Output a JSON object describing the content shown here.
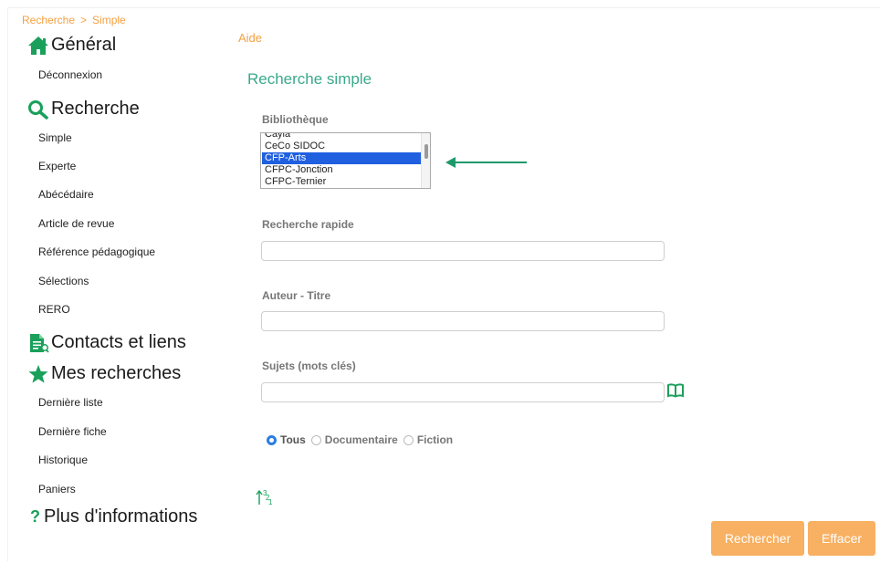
{
  "breadcrumb": {
    "part1": "Recherche",
    "sep": ">",
    "part2": "Simple"
  },
  "sidebar": {
    "general": {
      "title": "Général",
      "items": [
        "Déconnexion"
      ]
    },
    "recherche": {
      "title": "Recherche",
      "items": [
        "Simple",
        "Experte",
        "Abécédaire",
        "Article de revue",
        "Référence pédagogique",
        "Sélections",
        "RERO"
      ]
    },
    "contacts": {
      "title": "Contacts et liens"
    },
    "mes_recherches": {
      "title": "Mes recherches",
      "items": [
        "Dernière liste",
        "Dernière fiche",
        "Historique",
        "Paniers"
      ]
    },
    "plus": {
      "title": "Plus d'informations"
    }
  },
  "main": {
    "help": "Aide",
    "title": "Recherche simple",
    "bibliotheque": {
      "label": "Bibliothèque",
      "options": [
        "Cayla",
        "CeCo SIDOC",
        "CFP-Arts",
        "CFPC-Jonction",
        "CFPC-Ternier"
      ],
      "selected": "CFP-Arts"
    },
    "recherche_rapide": {
      "label": "Recherche rapide",
      "value": "",
      "placeholder": ""
    },
    "auteur_titre": {
      "label": "Auteur - Titre",
      "value": "",
      "placeholder": ""
    },
    "sujets": {
      "label": "Sujets (mots clés)",
      "value": "",
      "placeholder": ""
    },
    "type_filter": {
      "options": [
        "Tous",
        "Documentaire",
        "Fiction"
      ],
      "selected": "Tous"
    },
    "buttons": {
      "search": "Rechercher",
      "clear": "Effacer"
    }
  },
  "colors": {
    "accent_orange": "#f5a042",
    "title_green": "#39a98a",
    "button_orange": "#f8b062",
    "selection_blue": "#1f5fe0",
    "icon_green": "#1aa05a"
  }
}
